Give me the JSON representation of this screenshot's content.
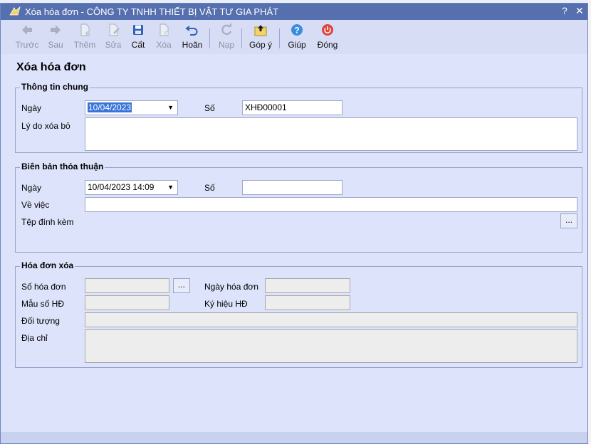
{
  "window": {
    "title": "Xóa hóa đơn - CÔNG TY TNHH THIẾT BỊ VẬT TƯ GIA PHÁT",
    "help": "?",
    "close": "✕"
  },
  "toolbar": {
    "back": "Trước",
    "next": "Sau",
    "add": "Thêm",
    "edit": "Sửa",
    "save": "Cất",
    "delete": "Xóa",
    "undo": "Hoãn",
    "reload": "Nạp",
    "feedback": "Góp ý",
    "help": "Giúp",
    "close": "Đóng"
  },
  "page_title": "Xóa hóa đơn",
  "general": {
    "title": "Thông tin chung",
    "date_label": "Ngày",
    "date_value": "10/04/2023",
    "number_label": "Số",
    "number_value": "XHĐ00001",
    "reason_label": "Lý do xóa bỏ",
    "reason_value": ""
  },
  "agreement": {
    "title": "Biên bản thỏa thuận",
    "date_label": "Ngày",
    "date_value": "10/04/2023 14:09",
    "number_label": "Số",
    "number_value": "",
    "subject_label": "Về việc",
    "subject_value": "",
    "attachment_label": "Tệp đính kèm",
    "attachment_button": "..."
  },
  "invoice": {
    "title": "Hóa đơn xóa",
    "invoice_no_label": "Số hóa đơn",
    "invoice_no_button": "...",
    "invoice_date_label": "Ngày hóa đơn",
    "template_label": "Mẫu số HĐ",
    "series_label": "Ký hiệu HĐ",
    "customer_label": "Đối tượng",
    "address_label": "Địa chỉ"
  },
  "icons": {
    "accent": "#566fae",
    "help_blue": "#3b8de0",
    "close_red": "#e0443a"
  }
}
